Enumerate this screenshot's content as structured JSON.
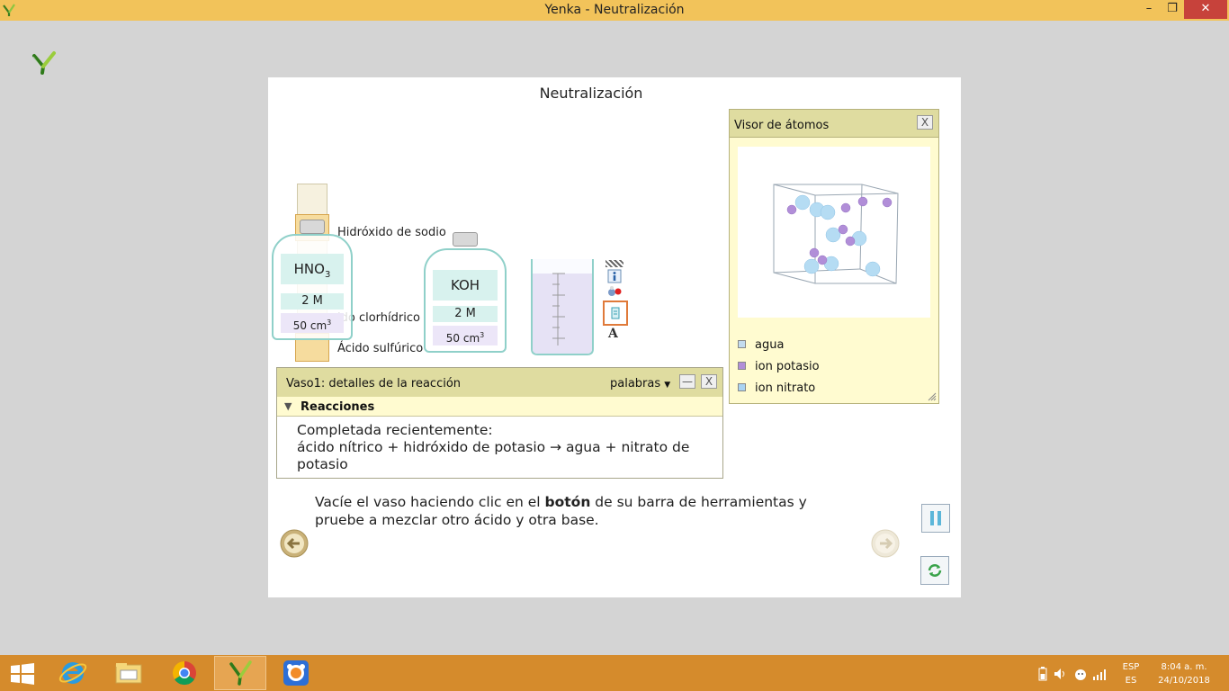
{
  "window": {
    "title": "Yenka - Neutralización",
    "minimize": "–",
    "maximize": "❐",
    "close": "✕"
  },
  "card": {
    "title": "Neutralización",
    "labels": {
      "sodium_hydroxide": "Hidróxido de sodio",
      "hydrochloric": "ido clorhídrico",
      "sulfuric": "Ácido sulfúrico"
    },
    "bottle_acid": {
      "name": "HNO",
      "subscript": "3",
      "molarity": "2 M",
      "volume": "50 cm",
      "volume_sup": "3"
    },
    "bottle_base": {
      "name": "KOH",
      "molarity": "2 M",
      "volume": "50 cm",
      "volume_sup": "3"
    },
    "toolbar_letter": "A"
  },
  "atom_viewer": {
    "title": "Visor de átomos",
    "close": "X",
    "legend": [
      {
        "label": "agua",
        "color": "#c3dbee"
      },
      {
        "label": "ion potasio",
        "color": "#b18ed8"
      },
      {
        "label": "ion nitrato",
        "color": "#a9d3f2"
      }
    ]
  },
  "reaction_panel": {
    "title": "Vaso1: detalles de la reacción",
    "mode": "palabras",
    "minimize": "—",
    "close": "X",
    "section": "Reacciones",
    "line1": "Completada recientemente:",
    "line2": "ácido nítrico + hidróxido de potasio → agua + nitrato de potasio"
  },
  "instruction": {
    "before": "Vacíe el vaso haciendo clic en el ",
    "bold": "botón",
    "after": " de su barra de herramientas y pruebe a mezclar otro ácido y otra base."
  },
  "tray": {
    "lang1": "ESP",
    "lang2": "ES",
    "time": "8:04 a. m.",
    "date": "24/10/2018"
  }
}
